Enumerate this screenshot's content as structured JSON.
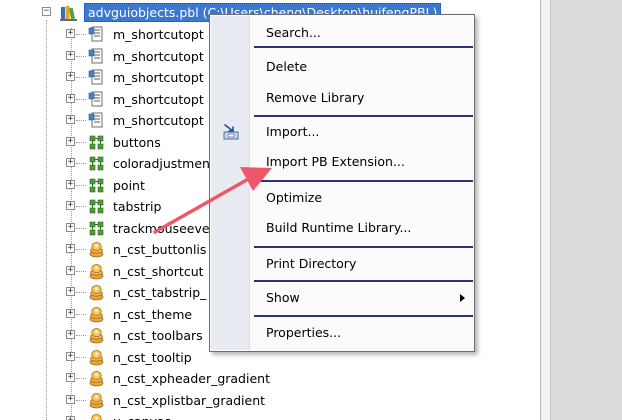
{
  "tree": {
    "root": {
      "label": "advguiobjects.pbl (C:\\Users\\cheng\\Desktop\\huifengPBL)",
      "icon": "library-icon",
      "expander": "−"
    },
    "items": [
      {
        "label": "m_shortcutopt",
        "icon": "menu-object-icon"
      },
      {
        "label": "m_shortcutopt",
        "icon": "menu-object-icon"
      },
      {
        "label": "m_shortcutopt",
        "icon": "menu-object-icon"
      },
      {
        "label": "m_shortcutopt",
        "icon": "menu-object-icon"
      },
      {
        "label": "m_shortcutopt",
        "icon": "menu-object-icon"
      },
      {
        "label": "buttons",
        "icon": "structure-object-icon"
      },
      {
        "label": "coloradjustmen",
        "icon": "structure-object-icon"
      },
      {
        "label": "point",
        "icon": "structure-object-icon"
      },
      {
        "label": "tabstrip",
        "icon": "structure-object-icon"
      },
      {
        "label": "trackmouseeve",
        "icon": "structure-object-icon"
      },
      {
        "label": "n_cst_buttonlis",
        "icon": "user-object-icon"
      },
      {
        "label": "n_cst_shortcut",
        "icon": "user-object-icon"
      },
      {
        "label": "n_cst_tabstrip_",
        "icon": "user-object-icon"
      },
      {
        "label": "n_cst_theme",
        "icon": "user-object-icon"
      },
      {
        "label": "n_cst_toolbars",
        "icon": "user-object-icon"
      },
      {
        "label": "n_cst_tooltip",
        "icon": "user-object-icon"
      },
      {
        "label": "n_cst_xpheader_gradient",
        "icon": "user-object-icon"
      },
      {
        "label": "n_cst_xplistbar_gradient",
        "icon": "user-object-icon"
      },
      {
        "label": "u_canvas",
        "icon": "user-object-icon"
      }
    ],
    "expander_symbol": "+"
  },
  "context_menu": {
    "items": [
      {
        "label": "Search..."
      },
      {
        "separator": true
      },
      {
        "label": "Delete"
      },
      {
        "label": "Remove Library"
      },
      {
        "separator": true
      },
      {
        "label": "Import...",
        "icon": "import-icon"
      },
      {
        "label": "Import PB Extension..."
      },
      {
        "separator": true
      },
      {
        "label": "Optimize"
      },
      {
        "label": "Build Runtime Library..."
      },
      {
        "separator": true
      },
      {
        "label": "Print Directory"
      },
      {
        "separator": true
      },
      {
        "label": "Show",
        "submenu": true
      },
      {
        "separator": true
      },
      {
        "label": "Properties..."
      }
    ]
  },
  "colors": {
    "selection": "#3a78d2",
    "separator": "#28337a",
    "callout_arrow": "#f0566a"
  }
}
